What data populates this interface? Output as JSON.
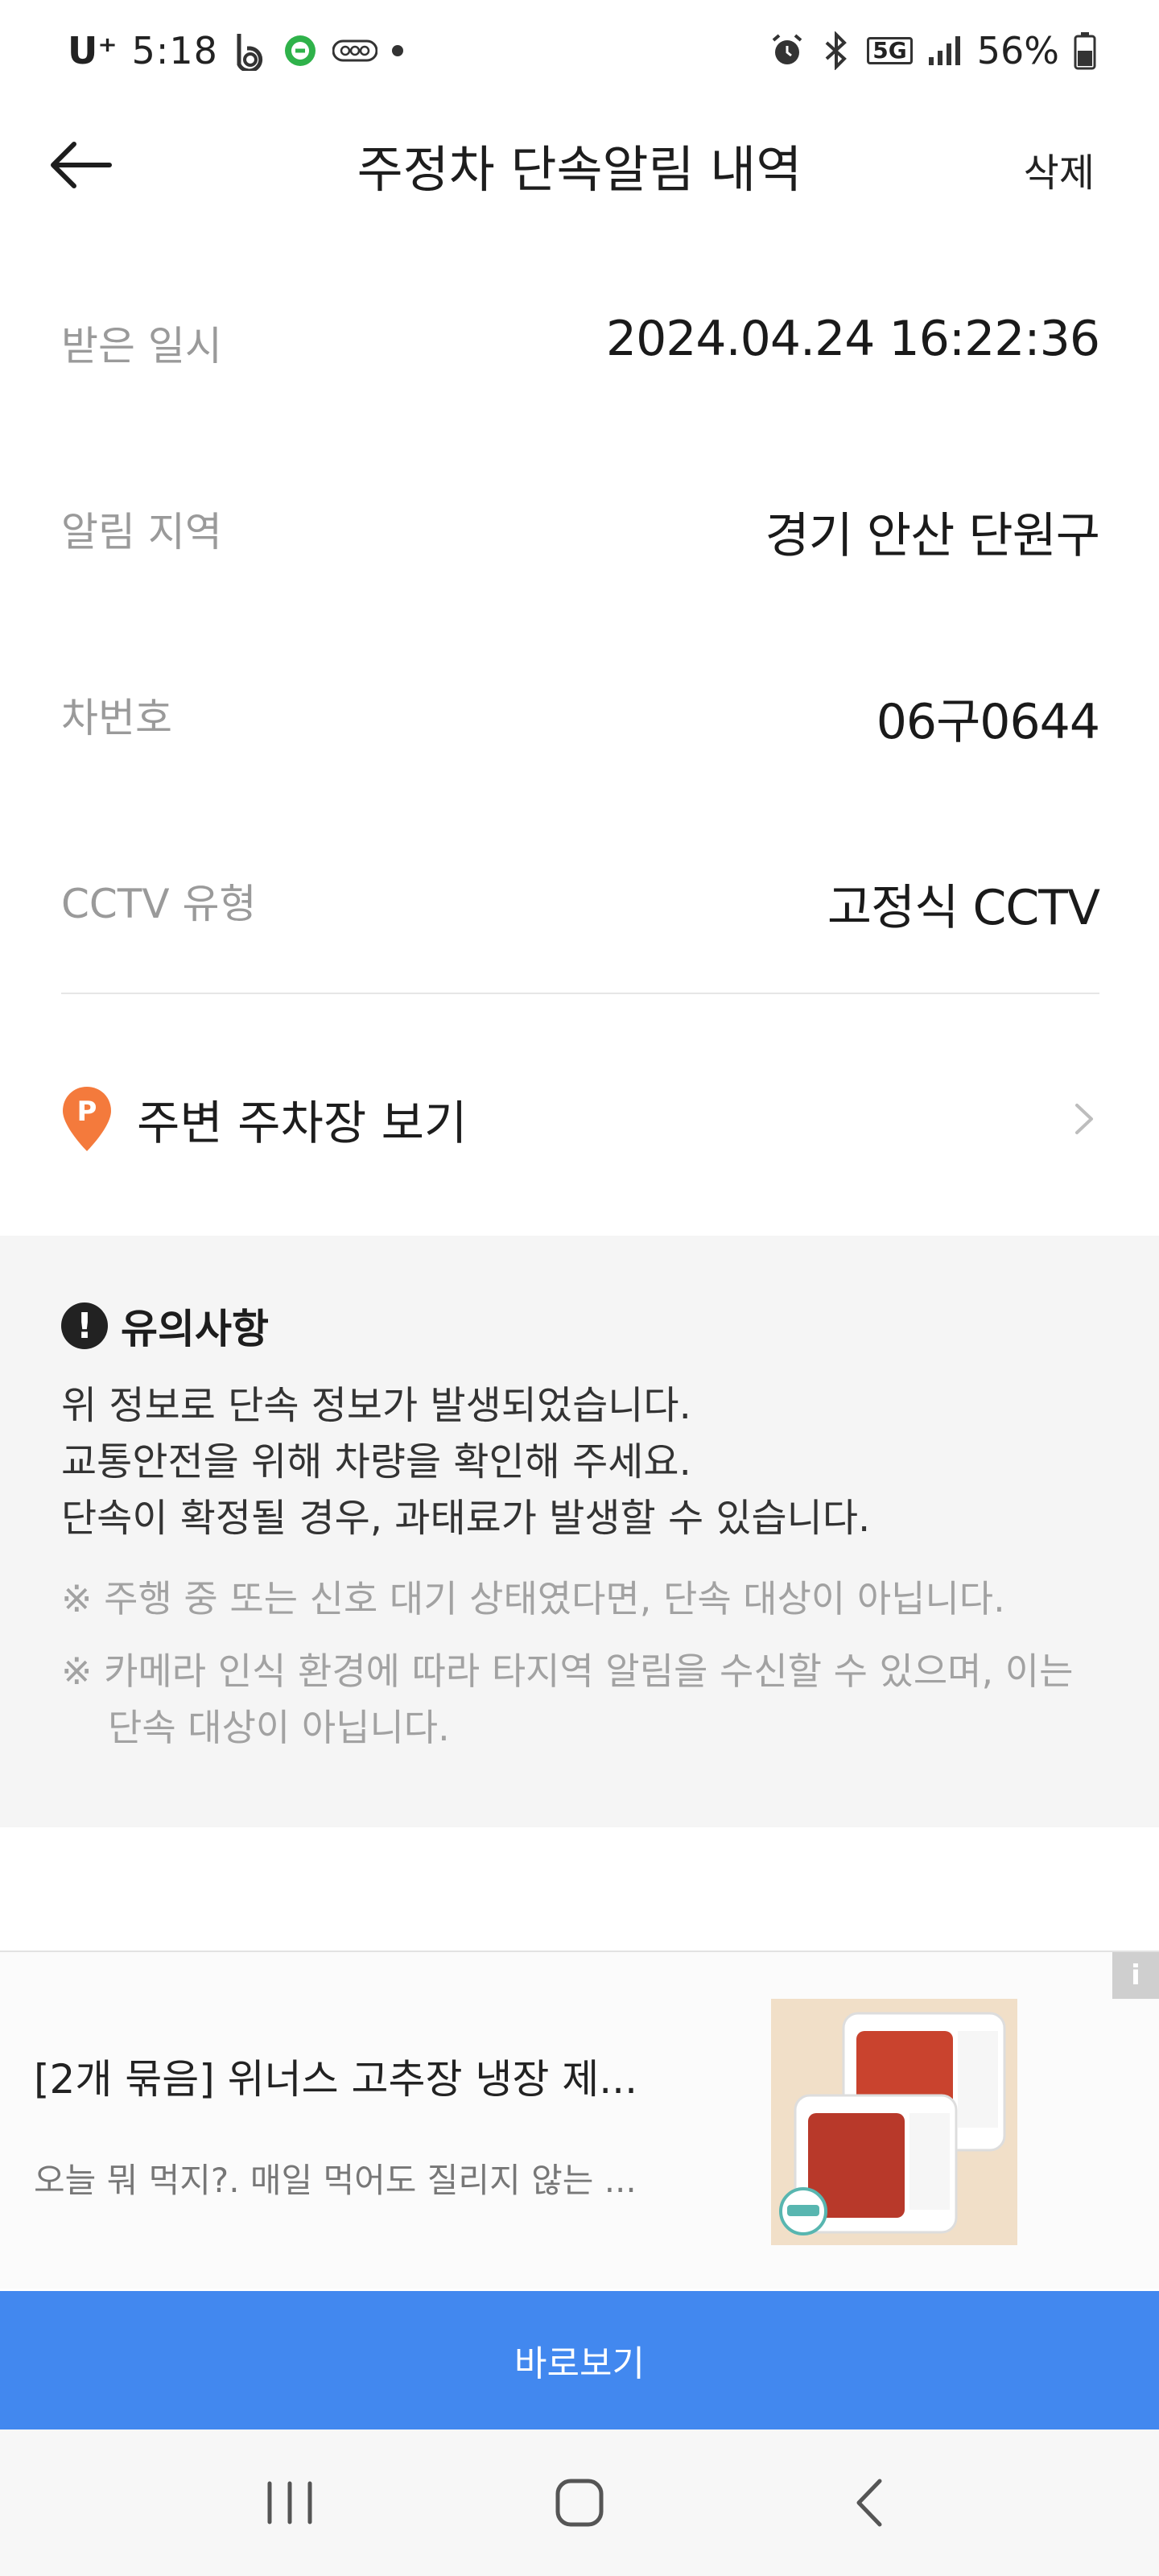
{
  "status_bar": {
    "carrier": "U⁺",
    "time": "5:18",
    "battery": "56%",
    "icons": [
      "b-app-icon",
      "green-app-icon",
      "ooo-app-icon",
      "dot-icon",
      "alarm-icon",
      "bluetooth-icon",
      "5g-icon",
      "signal-icon",
      "battery-icon"
    ],
    "network": "5G"
  },
  "header": {
    "title": "주정차 단속알림 내역",
    "delete_label": "삭제"
  },
  "details": [
    {
      "label": "받은 일시",
      "value": "2024.04.24 16:22:36"
    },
    {
      "label": "알림 지역",
      "value": "경기 안산 단원구"
    },
    {
      "label": "차번호",
      "value": "06구0644"
    },
    {
      "label": "CCTV 유형",
      "value": "고정식 CCTV"
    }
  ],
  "parking": {
    "label": "주변 주차장 보기",
    "icon_letter": "P",
    "accent": "#f47a3c"
  },
  "notice": {
    "icon": "!",
    "title": "유의사항",
    "lines": [
      "위 정보로 단속 정보가 발생되었습니다.",
      "교통안전을 위해 차량을 확인해 주세요.",
      "단속이 확정될 경우, 과태료가 발생할 수 있습니다."
    ],
    "sub_notes": [
      "※ 주행 중 또는 신호 대기 상태였다면, 단속 대상이 아닙니다.",
      "※ 카메라 인식 환경에 따라 타지역 알림을 수신할 수 있으며, 이는 단속 대상이 아닙니다."
    ]
  },
  "ad": {
    "info_badge": "i",
    "title": "[2개 묶음] 위너스 고추장 냉장 제...",
    "description": "오늘 뭐 먹지?. 매일 먹어도 질리지 않는 ...",
    "cta": "바로보기",
    "cta_color": "#4288ef"
  },
  "nav": {
    "icons": [
      "recent-apps-icon",
      "home-icon",
      "back-icon"
    ]
  }
}
